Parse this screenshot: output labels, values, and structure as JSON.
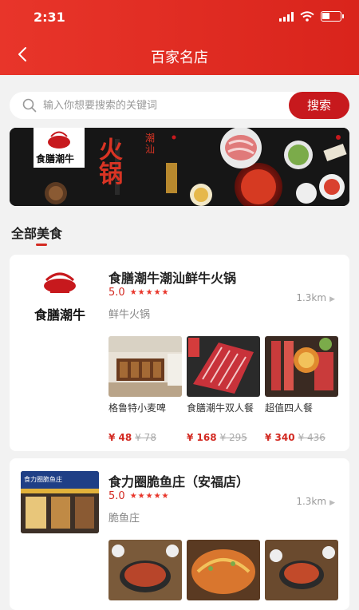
{
  "status_bar": {
    "time": "2:31",
    "battery_level": 0.45
  },
  "header": {
    "title": "百家名店",
    "back_icon": "chevron-left-icon"
  },
  "search": {
    "placeholder": "输入你想要搜索的关键词",
    "button_label": "搜索"
  },
  "banner": {
    "logo_text": "食膳潮牛",
    "headline": "火锅",
    "tagline": "潮汕"
  },
  "section": {
    "title": "全部美食"
  },
  "colors": {
    "brand_red": "#d32a22",
    "header_red": "#e8352a",
    "button_red": "#c7191d"
  },
  "stores": [
    {
      "name": "食膳潮牛潮汕鲜牛火锅",
      "logo_text": "食膳潮牛",
      "rating": "5.0",
      "stars": "★★★★★",
      "distance": "1.3km",
      "category": "鲜牛火锅",
      "deals": [
        {
          "name": "格鲁特小麦啤",
          "price": "¥ 48",
          "old_price": "¥ 78"
        },
        {
          "name": "食膳潮牛双人餐",
          "price": "¥ 168",
          "old_price": "¥ 295"
        },
        {
          "name": "超值四人餐",
          "price": "¥ 340",
          "old_price": "¥ 436"
        }
      ]
    },
    {
      "name": "食力圈脆鱼庄（安福店）",
      "logo_text": "食力圈脆鱼庄",
      "rating": "5.0",
      "stars": "★★★★★",
      "distance": "1.3km",
      "category": "脆鱼庄"
    }
  ]
}
